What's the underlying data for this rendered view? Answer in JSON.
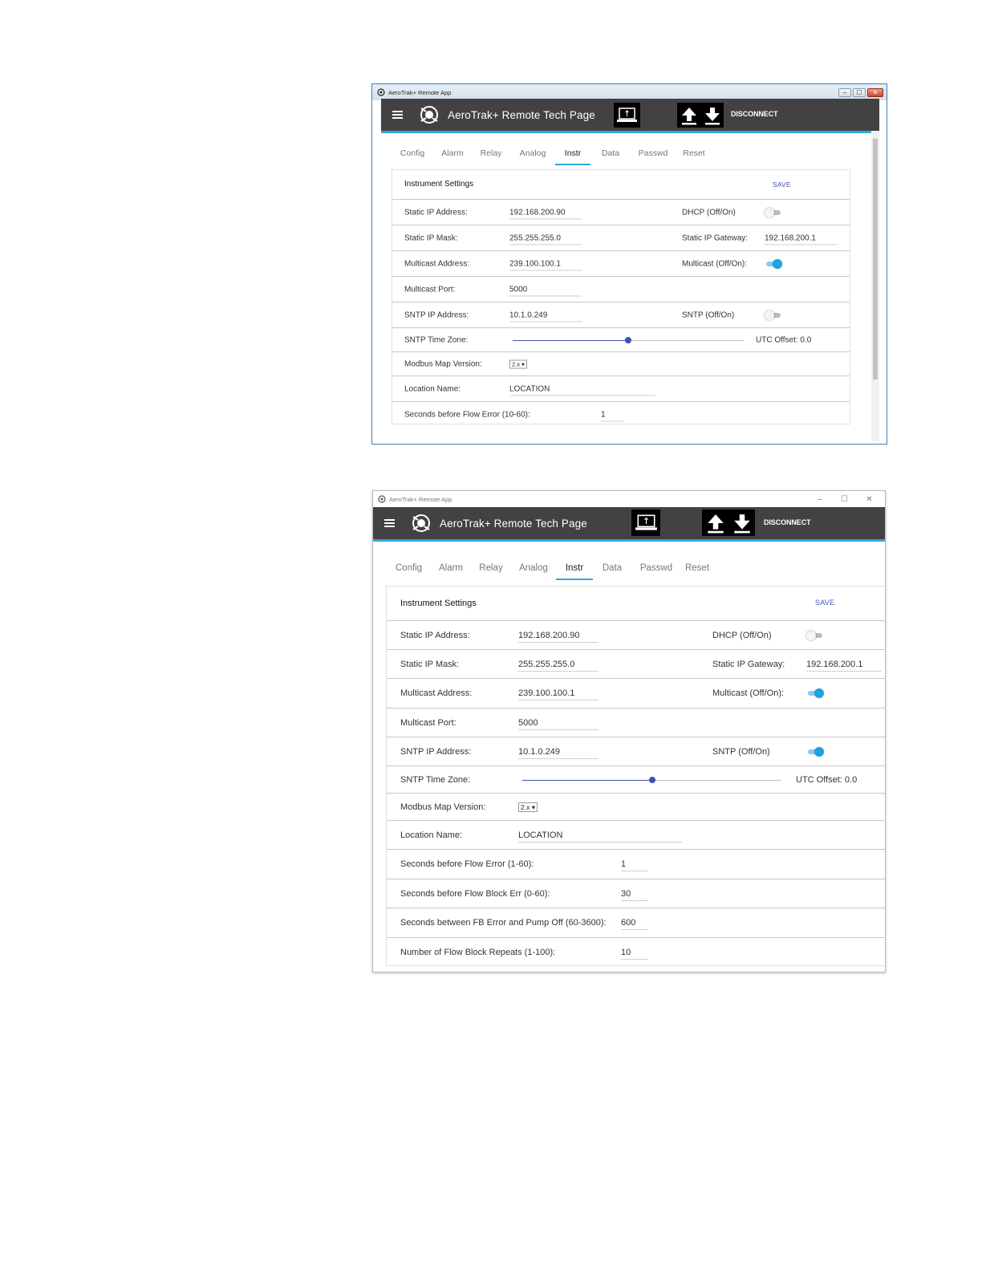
{
  "window": {
    "title": "AeroTrak+ Remote App",
    "app_title": "AeroTrak+ Remote Tech Page",
    "disconnect_label": "DISCONNECT",
    "min_label": "–",
    "max_label": "☐",
    "close_label": "✕"
  },
  "tabs": [
    "Config",
    "Alarm",
    "Relay",
    "Analog",
    "Instr",
    "Data",
    "Passwd",
    "Reset"
  ],
  "active_tab": "Instr",
  "card": {
    "title": "Instrument Settings",
    "save_label": "SAVE"
  },
  "fields": {
    "static_ip_label": "Static IP Address:",
    "static_ip_value": "192.168.200.90",
    "dhcp_label": "DHCP (Off/On)",
    "mask_label": "Static IP Mask:",
    "mask_value": "255.255.255.0",
    "gateway_label": "Static IP Gateway:",
    "gateway_value": "192.168.200.1",
    "multicast_address_label": "Multicast Address:",
    "multicast_address_value": "239.100.100.1",
    "multicast_toggle_label": "Multicast (Off/On):",
    "multicast_port_label": "Multicast Port:",
    "multicast_port_value": "5000",
    "sntp_ip_label": "SNTP IP Address:",
    "sntp_ip_value": "10.1.0.249",
    "sntp_toggle_label": "SNTP (Off/On)",
    "sntp_timezone_label": "SNTP Time Zone:",
    "utc_offset_label": "UTC Offset: 0.0",
    "modbus_label": "Modbus Map Version:",
    "modbus_value": "2.x ▾",
    "location_label": "Location Name:",
    "location_value": "LOCATION"
  },
  "window1": {
    "flow_error_label": "Seconds before Flow Error (10-60):",
    "flow_error_value": "1",
    "dhcp_on": false,
    "multicast_on": true,
    "sntp_on": false,
    "timezone_fraction": 0.5
  },
  "window2": {
    "flow_error_label": "Seconds before Flow Error (1-60):",
    "flow_error_value": "1",
    "flow_block_label": "Seconds before Flow Block Err (0-60):",
    "flow_block_value": "30",
    "fb_pump_label": "Seconds between FB Error and Pump Off (60-3600):",
    "fb_pump_value": "600",
    "repeats_label": "Number of Flow Block Repeats (1-100):",
    "repeats_value": "10",
    "dhcp_on": false,
    "multicast_on": true,
    "sntp_on": true,
    "timezone_fraction": 0.5
  }
}
